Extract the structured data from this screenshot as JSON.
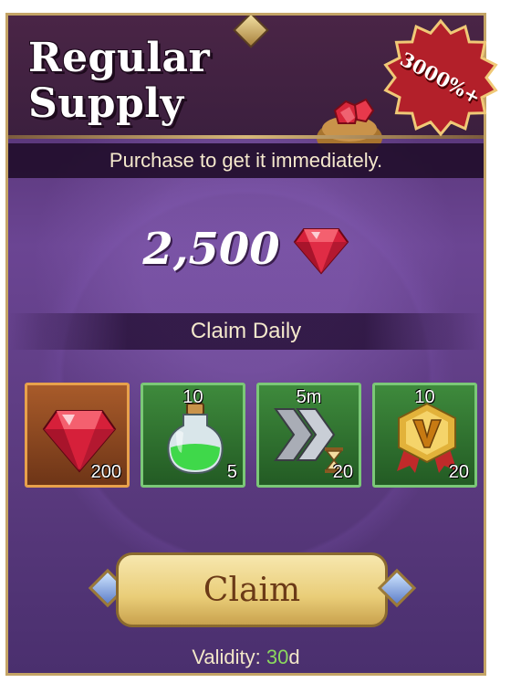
{
  "header": {
    "title_line1": "Regular",
    "title_line2": "Supply",
    "badge": "3000%+",
    "subtitle": "Purchase to get it immediately."
  },
  "reward": {
    "amount": "2,500",
    "currency_icon": "ruby-gem-icon"
  },
  "claim_daily_label": "Claim Daily",
  "items": [
    {
      "icon": "ruby-gem-icon",
      "top": "",
      "bottom": "200",
      "rarity_color": "#a85b2a"
    },
    {
      "icon": "green-potion-icon",
      "top": "10",
      "bottom": "5",
      "rarity_color": "#3e8a3c"
    },
    {
      "icon": "speedup-hourglass-icon",
      "top": "5m",
      "bottom": "20",
      "rarity_color": "#3e8a3c"
    },
    {
      "icon": "gold-medal-icon",
      "top": "10",
      "bottom": "20",
      "rarity_color": "#3e8a3c"
    }
  ],
  "claim_button_label": "Claim",
  "validity": {
    "label": "Validity: ",
    "value": "30",
    "unit": "d"
  }
}
